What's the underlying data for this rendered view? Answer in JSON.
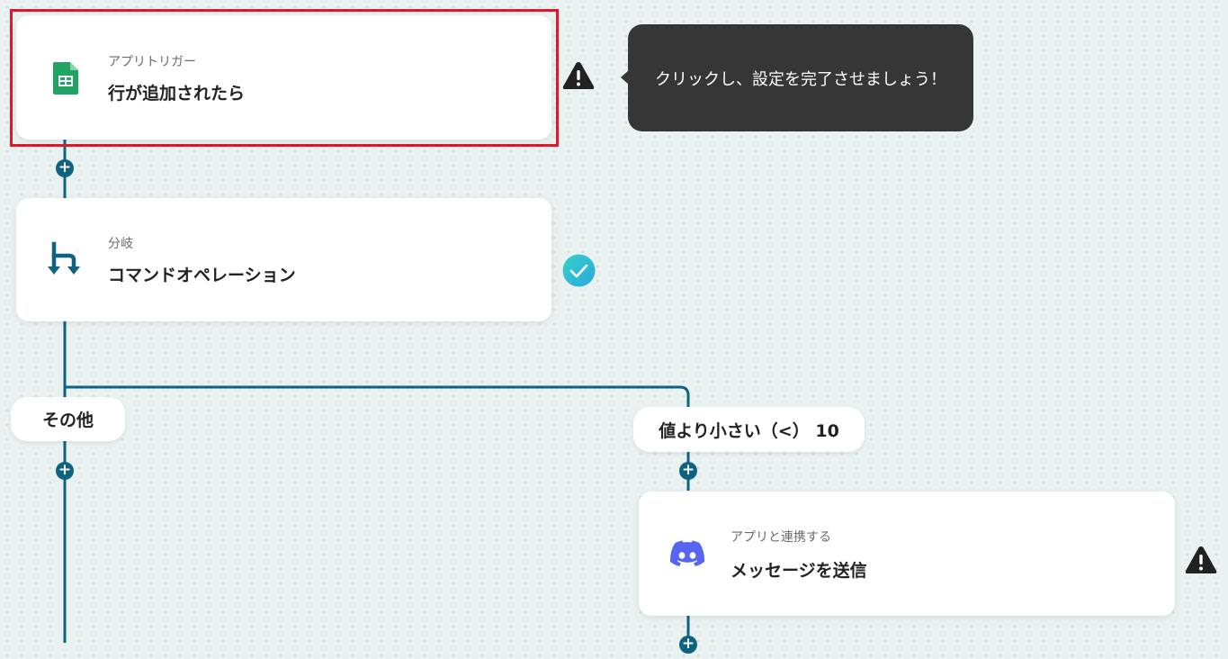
{
  "steps": [
    {
      "subtitle": "アプリトリガー",
      "title": "行が追加されたら",
      "icon": "google-sheets-icon",
      "status": "warning"
    },
    {
      "subtitle": "分岐",
      "title": "コマンドオペレーション",
      "icon": "branch-icon",
      "status": "done"
    },
    {
      "subtitle": "アプリと連携する",
      "title": "メッセージを送信",
      "icon": "discord-icon",
      "status": "warning"
    }
  ],
  "tooltip": {
    "text": "クリックし、設定を完了させましょう！"
  },
  "branches": {
    "other_label": "その他",
    "condition_label": "値より小さい（<） 10"
  },
  "colors": {
    "connector": "#0e6380",
    "highlight": "#e3172b",
    "tooltip_bg": "#363636",
    "check": "#2ec4d6",
    "sheets_green": "#1fa463",
    "discord": "#5865f2"
  }
}
